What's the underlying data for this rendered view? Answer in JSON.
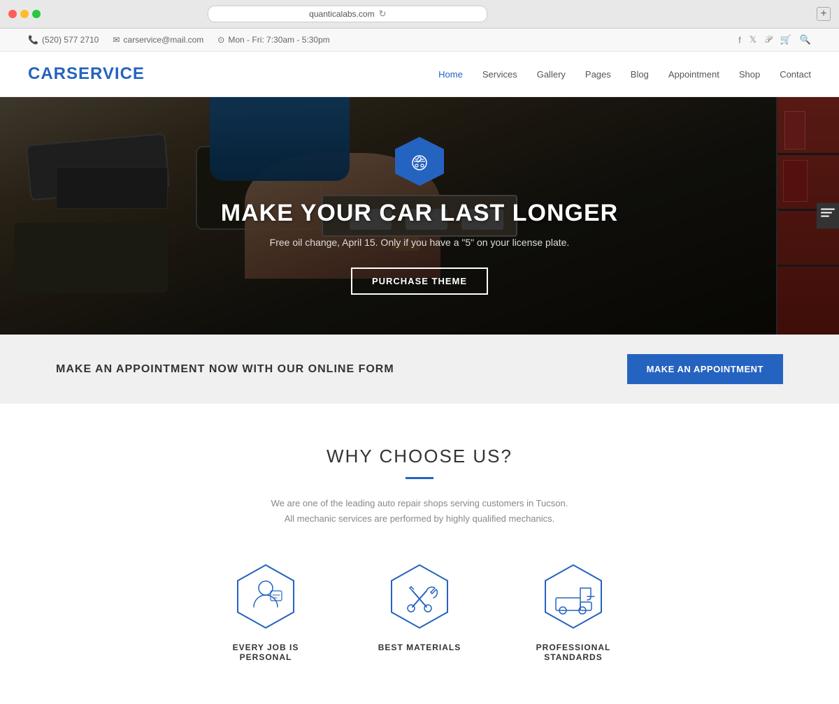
{
  "browser": {
    "url": "quanticalabs.com",
    "new_tab_label": "+"
  },
  "topbar": {
    "phone": "(520) 577 2710",
    "email": "carservice@mail.com",
    "hours": "Mon - Fri: 7:30am - 5:30pm",
    "icons": [
      "facebook",
      "twitter",
      "pinterest",
      "cart",
      "search"
    ]
  },
  "nav": {
    "logo": "CARSERVICE",
    "links": [
      {
        "label": "Home",
        "active": true
      },
      {
        "label": "Services",
        "active": false
      },
      {
        "label": "Gallery",
        "active": false
      },
      {
        "label": "Pages",
        "active": false
      },
      {
        "label": "Blog",
        "active": false
      },
      {
        "label": "Appointment",
        "active": false
      },
      {
        "label": "Shop",
        "active": false
      },
      {
        "label": "Contact",
        "active": false
      }
    ]
  },
  "hero": {
    "icon": "🚗",
    "title": "MAKE YOUR CAR LAST LONGER",
    "subtitle": "Free oil change, April 15. Only if you have a \"5\" on your license plate.",
    "button_label": "PURCHASE THEME"
  },
  "appointment_banner": {
    "text": "MAKE AN APPOINTMENT NOW WITH OUR ONLINE FORM",
    "button_label": "MAKE AN APPOINTMENT"
  },
  "why_section": {
    "title": "WHY CHOOSE US?",
    "description_line1": "We are one of the leading auto repair shops serving customers in Tucson.",
    "description_line2": "All mechanic services are performed by highly qualified mechanics.",
    "features": [
      {
        "label": "EVERY JOB IS PERSONAL",
        "icon": "👤",
        "icon_name": "person-chat-icon"
      },
      {
        "label": "BEST MATERIALS",
        "icon": "🔧",
        "icon_name": "wrench-icon"
      },
      {
        "label": "PROFESSIONAL STANDARDS",
        "icon": "🏗",
        "icon_name": "tow-truck-icon"
      }
    ]
  },
  "colors": {
    "primary": "#2563C0",
    "dark": "#333333",
    "light_bg": "#f0f0f0",
    "text_gray": "#888888"
  }
}
